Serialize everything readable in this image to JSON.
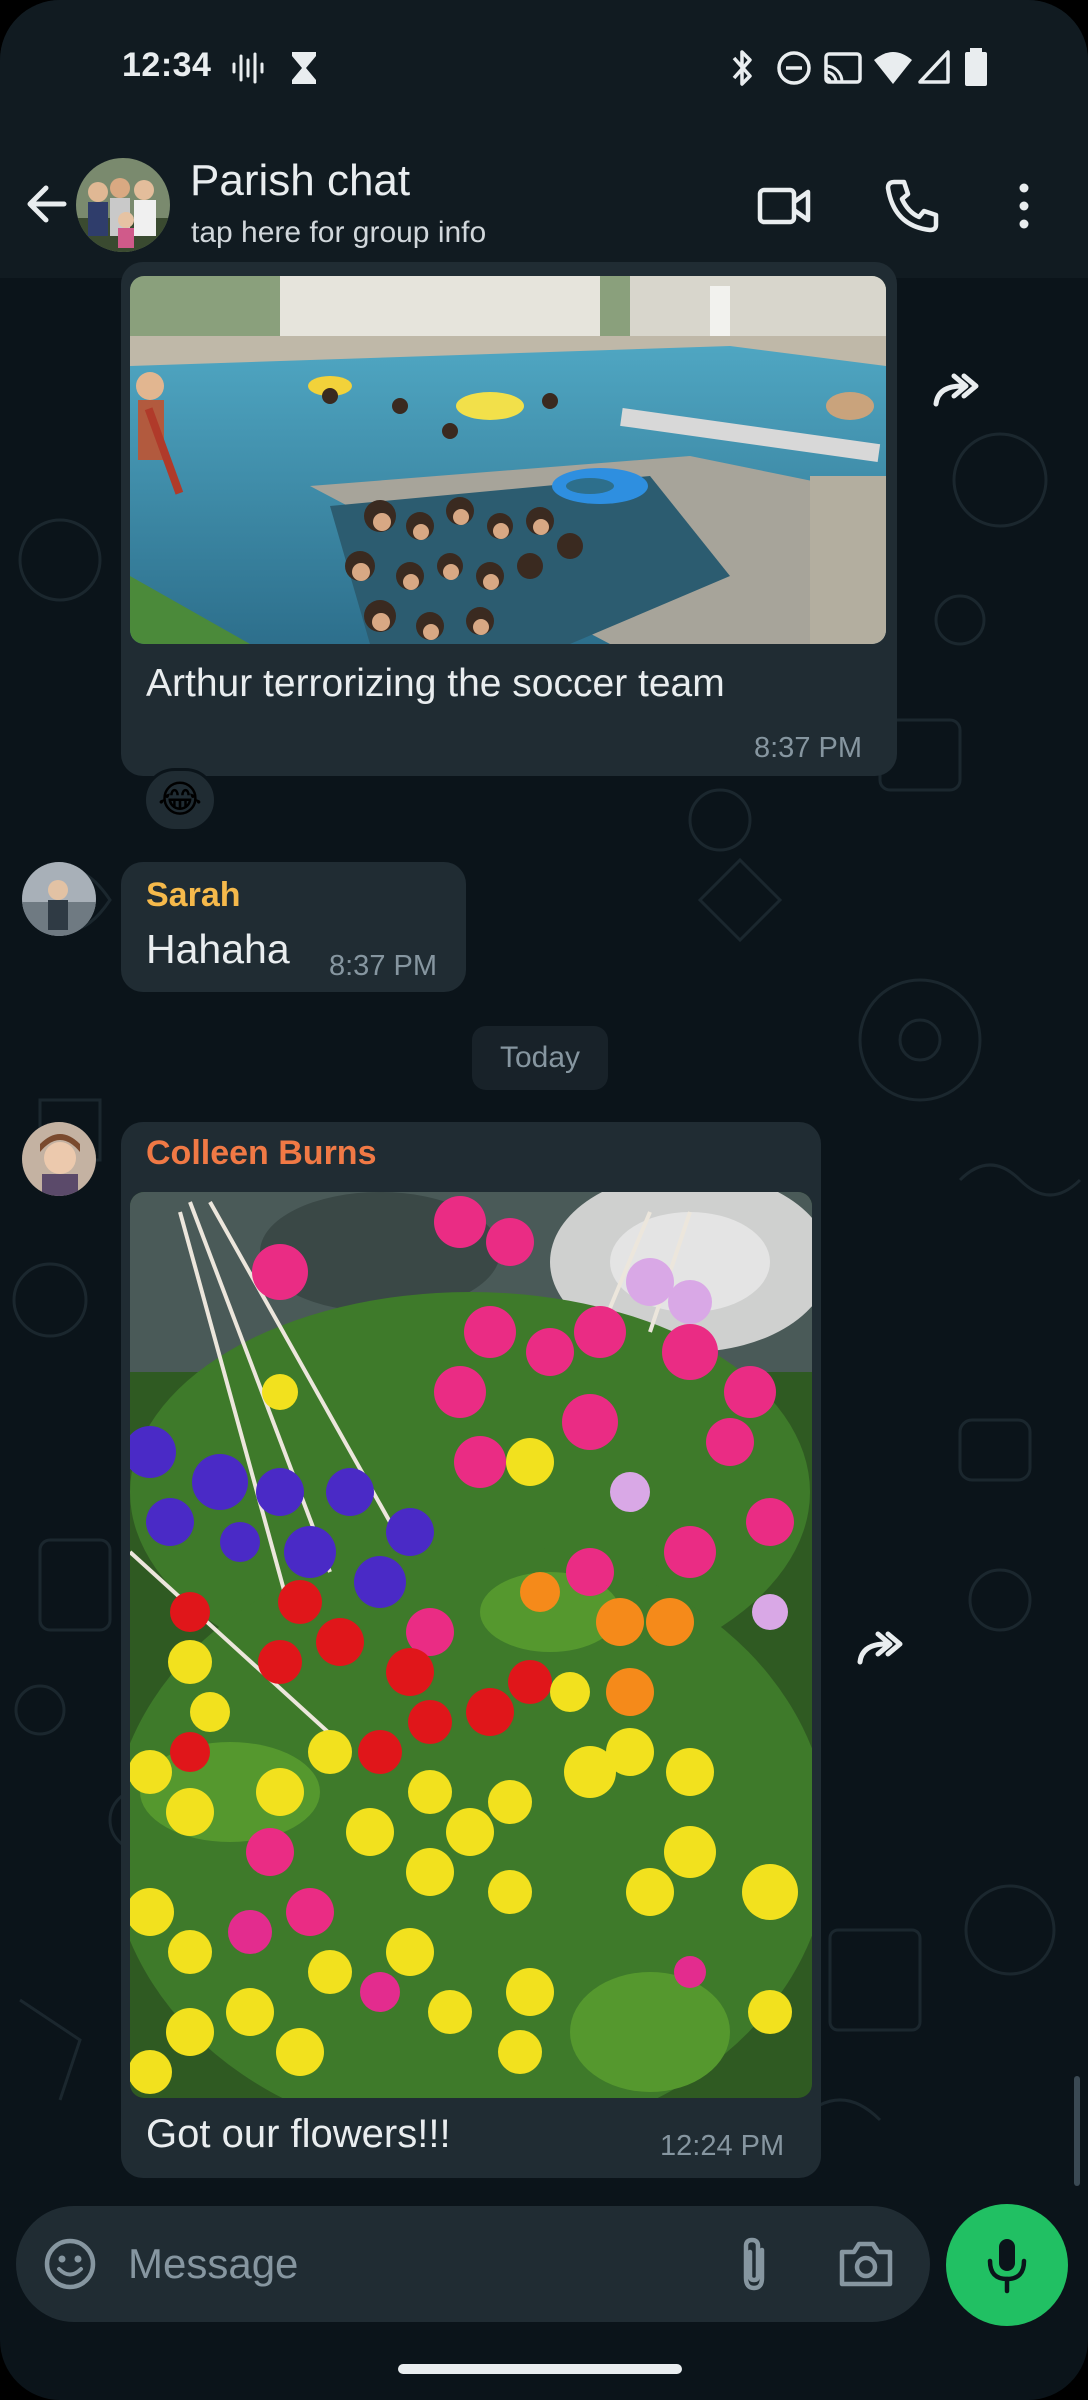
{
  "status_bar": {
    "time": "12:34",
    "left_icons": [
      "voice-waveform-icon",
      "hourglass-icon"
    ],
    "right_icons": [
      "bluetooth-icon",
      "do-not-disturb-icon",
      "cast-icon",
      "wifi-icon",
      "signal-icon",
      "battery-icon"
    ]
  },
  "header": {
    "title": "Parish chat",
    "subtitle": "tap here for group info",
    "actions": [
      "video-call-icon",
      "voice-call-icon",
      "more-options-icon"
    ]
  },
  "messages": [
    {
      "type": "image",
      "image_description": "backyard pool",
      "caption": "Arthur terrorizing the soccer team",
      "time": "8:37 PM",
      "reaction": "😂"
    },
    {
      "type": "text",
      "sender": "Sarah",
      "sender_color": "#f5b94b",
      "text": "Hahaha",
      "time": "8:37 PM"
    },
    {
      "type": "date_divider",
      "label": "Today"
    },
    {
      "type": "image",
      "sender": "Colleen Burns",
      "sender_color": "#f07945",
      "image_description": "hanging flower baskets",
      "caption": "Got our flowers!!!",
      "time": "12:24 PM"
    }
  ],
  "composer": {
    "placeholder": "Message",
    "icons": [
      "emoji-icon",
      "attach-icon",
      "camera-icon",
      "microphone-icon"
    ]
  },
  "colors": {
    "background": "#0b141a",
    "bar": "#111b21",
    "bubble": "#202c33",
    "accent": "#21c063"
  }
}
